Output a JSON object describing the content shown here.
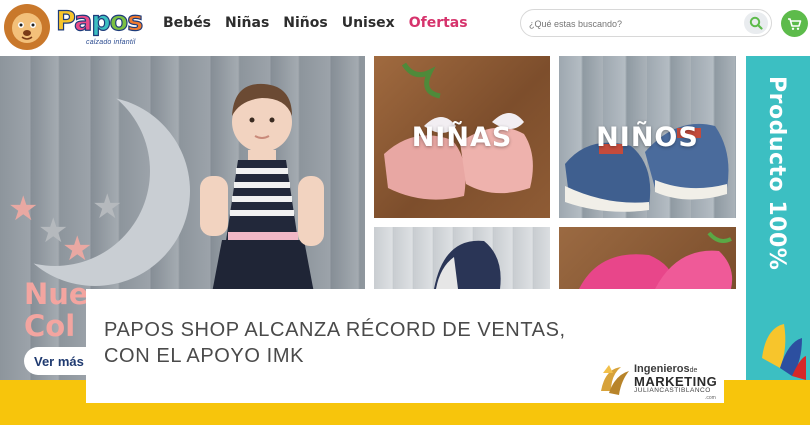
{
  "brand": {
    "name": "Papos",
    "tagline": "calzado infantil"
  },
  "nav": {
    "items": [
      "Bebés",
      "Niñas",
      "Niños",
      "Unisex",
      "Ofertas"
    ]
  },
  "search": {
    "placeholder": "¿Qué estas buscando?"
  },
  "hero": {
    "text_line1": "Nue",
    "text_line2": "Col",
    "button_label": "Ver más"
  },
  "categories": {
    "girls_label": "NIÑAS",
    "boys_label": "NIÑOS"
  },
  "promo": {
    "text": "Producto 100%"
  },
  "article": {
    "headline_line1": "PAPOS SHOP ALCANZA RÉCORD DE VENTAS,",
    "headline_line2": "CON EL APOYO IMK"
  },
  "credit": {
    "line1": "Ingenieros",
    "line1_small": "de",
    "line2": "MARKETING",
    "line3": "JULIANCASTIBLANCO",
    "line4": ".com"
  },
  "colors": {
    "accent_sale": "#d6336c",
    "cart_green": "#5dbb4b",
    "promo_teal": "#3cbfc2",
    "band_yellow": "#f7c50c"
  },
  "icons": [
    "lion-logo-icon",
    "search-icon",
    "cart-icon",
    "moon-icon",
    "star-icon",
    "imk-logo-icon"
  ]
}
